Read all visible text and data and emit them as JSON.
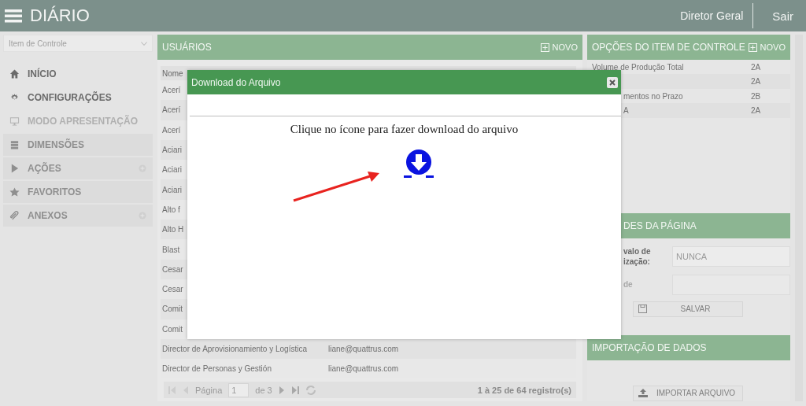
{
  "header": {
    "title": "DIÁRIO",
    "user": "Diretor Geral",
    "logout": "Sair"
  },
  "sidebar": {
    "select_placeholder": "Item de Controle",
    "items": [
      {
        "label": "INÍCIO",
        "kind": "plain",
        "disabled": false,
        "addable": false
      },
      {
        "label": "CONFIGURAÇÕES",
        "kind": "plain",
        "disabled": false,
        "addable": false
      },
      {
        "label": "MODO APRESENTAÇÃO",
        "kind": "plain",
        "disabled": true,
        "addable": false
      },
      {
        "label": "DIMENSÕES",
        "kind": "section",
        "disabled": false,
        "addable": false
      },
      {
        "label": "AÇÕES",
        "kind": "section",
        "disabled": false,
        "addable": true
      },
      {
        "label": "FAVORITOS",
        "kind": "section",
        "disabled": false,
        "addable": false
      },
      {
        "label": "ANEXOS",
        "kind": "section",
        "disabled": false,
        "addable": true
      }
    ]
  },
  "users": {
    "title": "USUÁRIOS",
    "new_button": "NOVO",
    "columns": [
      "Nome"
    ],
    "rows": [
      {
        "name": "Acerí"
      },
      {
        "name": "Acerí"
      },
      {
        "name": "Acerí"
      },
      {
        "name": "Aciari"
      },
      {
        "name": "Aciari"
      },
      {
        "name": "Aciari"
      },
      {
        "name": "Alto f"
      },
      {
        "name": "Alto H"
      },
      {
        "name": "Blast"
      },
      {
        "name": "Cesar"
      },
      {
        "name": "Cesar"
      },
      {
        "name": "Comit"
      },
      {
        "name": "Comit"
      },
      {
        "name": "Director de Aprovisionamiento y Logística",
        "email": "liane@quattrus.com"
      },
      {
        "name": "Director de Personas y Gestión",
        "email": "liane@quattrus.com"
      }
    ],
    "pager": {
      "page_label": "Página",
      "page": "1",
      "of": "de 3",
      "summary": "1 à 25 de 64 registro(s)"
    }
  },
  "options": {
    "title": "OPÇÕES DO ITEM DE CONTROLE",
    "new_button": "NOVO",
    "rows": [
      {
        "name": "Volume de Produção Total",
        "code": "2A",
        "covered": false
      },
      {
        "code": "2A"
      },
      {
        "name": "mentos no Prazo",
        "code": "2B",
        "covered": true
      },
      {
        "name": "A",
        "code": "2A",
        "covered": true
      }
    ]
  },
  "settings": {
    "title": "DES DA PÁGINA",
    "fields": [
      {
        "label": [
          "valo de",
          "ização:"
        ],
        "value": "NUNCA",
        "disabled": false
      },
      {
        "label": [
          "de"
        ],
        "disabled": true
      }
    ],
    "save_button": "SALVAR"
  },
  "import": {
    "title": "IMPORTAÇÃO DE DADOS",
    "button": "IMPORTAR ARQUIVO"
  },
  "modal": {
    "title": "Download do Arquivo",
    "message": "Clique no ícone para fazer download do arquivo"
  }
}
